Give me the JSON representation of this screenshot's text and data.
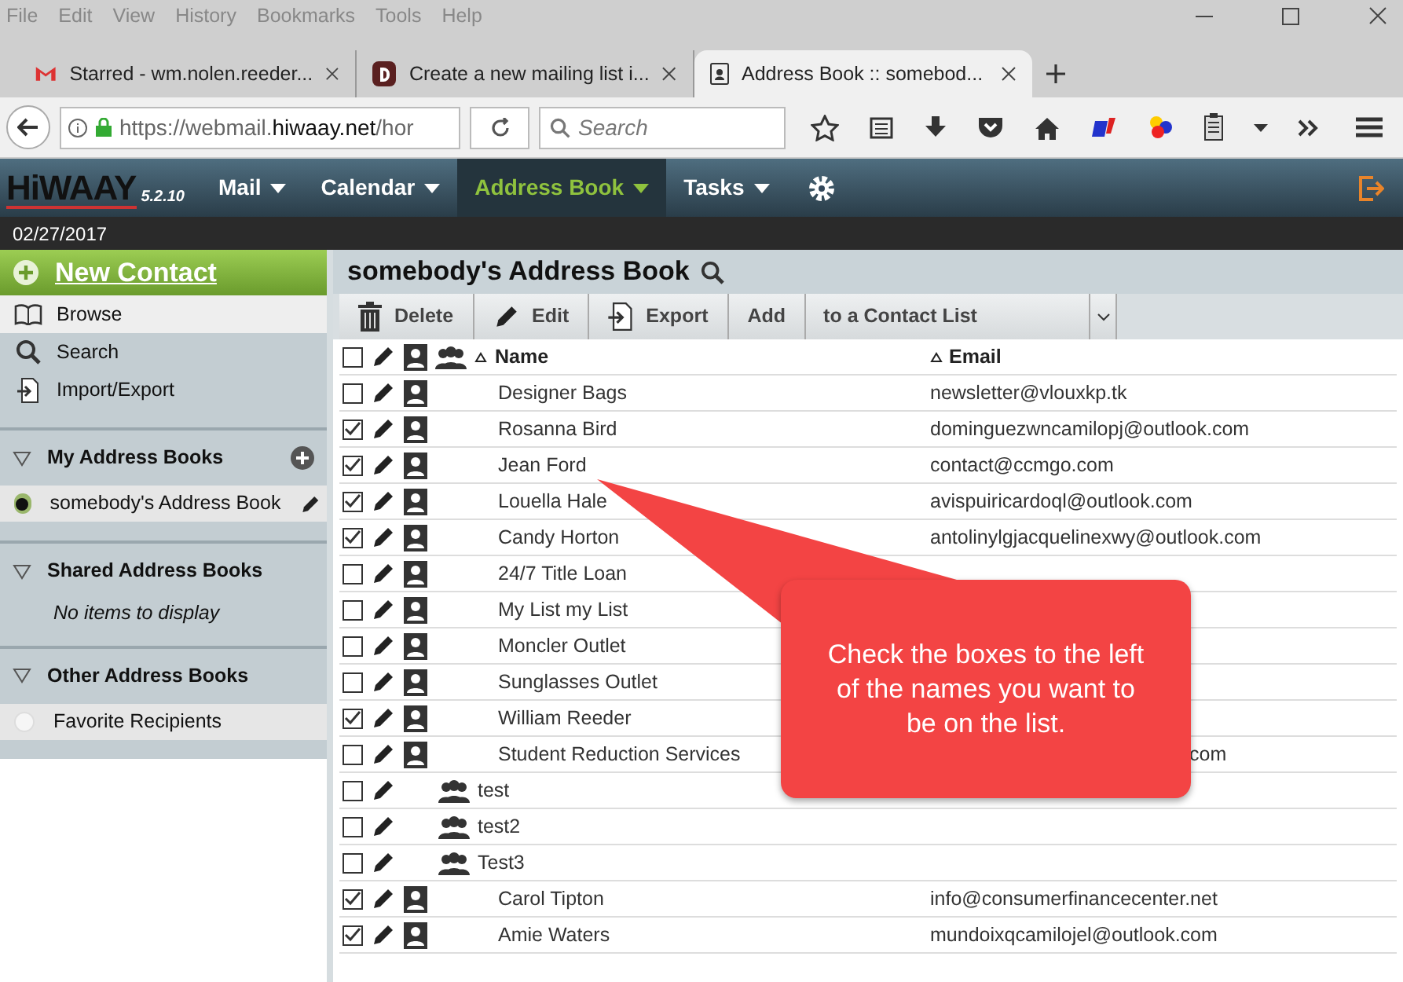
{
  "menu_bar": [
    "File",
    "Edit",
    "View",
    "History",
    "Bookmarks",
    "Tools",
    "Help"
  ],
  "tabs": [
    {
      "title": "Starred - wm.nolen.reeder...",
      "selected": false
    },
    {
      "title": "Create a new mailing list i...",
      "selected": false
    },
    {
      "title": "Address Book :: somebod...",
      "selected": true
    }
  ],
  "address_bar": {
    "prefix": "https://webmail.",
    "domain": "hiwaay.net",
    "suffix": "/hor"
  },
  "search": {
    "placeholder": "Search"
  },
  "app": {
    "logo": "HiWAAY",
    "version": "5.2.10",
    "date": "02/27/2017"
  },
  "nav": [
    {
      "label": "Mail",
      "selected": false
    },
    {
      "label": "Calendar",
      "selected": false
    },
    {
      "label": "Address Book",
      "selected": true
    },
    {
      "label": "Tasks",
      "selected": false
    }
  ],
  "sidebar": {
    "new_contact": "New Contact",
    "links": [
      {
        "label": "Browse",
        "kind": "browse"
      },
      {
        "label": "Search",
        "kind": "search"
      },
      {
        "label": "Import/Export",
        "kind": "import"
      }
    ],
    "sections": [
      {
        "title": "My Address Books",
        "add": true,
        "items": [
          {
            "label": "somebody's Address Book",
            "selected": true,
            "editable": true
          }
        ]
      },
      {
        "title": "Shared Address Books",
        "add": false,
        "empty": "No items to display"
      },
      {
        "title": "Other Address Books",
        "add": false,
        "items": [
          {
            "label": "Favorite Recipients",
            "selected": false,
            "editable": false
          }
        ]
      }
    ]
  },
  "main": {
    "title": "somebody's Address Book",
    "toolbar": [
      {
        "label": "Delete",
        "kind": "delete"
      },
      {
        "label": "Edit",
        "kind": "edit"
      },
      {
        "label": "Export",
        "kind": "export"
      },
      {
        "label": "Add",
        "kind": "plain"
      }
    ],
    "list_select": "to a Contact List",
    "select_all_checked": false,
    "columns": [
      "Name",
      "Email"
    ],
    "rows": [
      {
        "name": "Designer Bags",
        "email": "newsletter@vlouxkp.tk",
        "kind": "contact",
        "checked": false
      },
      {
        "name": "Rosanna Bird",
        "email": "dominguezwncamilopj@outlook.com",
        "kind": "contact",
        "checked": true
      },
      {
        "name": "Jean Ford",
        "email": "contact@ccmgo.com",
        "kind": "contact",
        "checked": true
      },
      {
        "name": "Louella Hale",
        "email": "avispuiricardoql@outlook.com",
        "kind": "contact",
        "checked": true
      },
      {
        "name": "Candy Horton",
        "email": "antolinylgjacquelinexwy@outlook.com",
        "kind": "contact",
        "checked": true
      },
      {
        "name": "24/7 Title Loan",
        "kind": "contact",
        "checked": false
      },
      {
        "name": "My List my List",
        "kind": "contact",
        "checked": false
      },
      {
        "name": "Moncler Outlet",
        "kind": "contact",
        "checked": false
      },
      {
        "name": "Sunglasses Outlet",
        "kind": "contact",
        "checked": false
      },
      {
        "name": "William Reeder",
        "kind": "contact",
        "checked": true
      },
      {
        "name": "Student Reduction Services",
        "email": "com",
        "email_partial": true,
        "kind": "contact",
        "checked": false
      },
      {
        "name": "test",
        "kind": "group",
        "checked": false
      },
      {
        "name": "test2",
        "kind": "group",
        "checked": false
      },
      {
        "name": "Test3",
        "kind": "group",
        "checked": false
      },
      {
        "name": "Carol Tipton",
        "email": "info@consumerfinancecenter.net",
        "kind": "contact",
        "checked": true
      },
      {
        "name": "Amie Waters",
        "email": "mundoixqcamilojel@outlook.com",
        "kind": "contact",
        "checked": true
      }
    ]
  },
  "callout": "Check the boxes to the left of the names you want to be on the list."
}
